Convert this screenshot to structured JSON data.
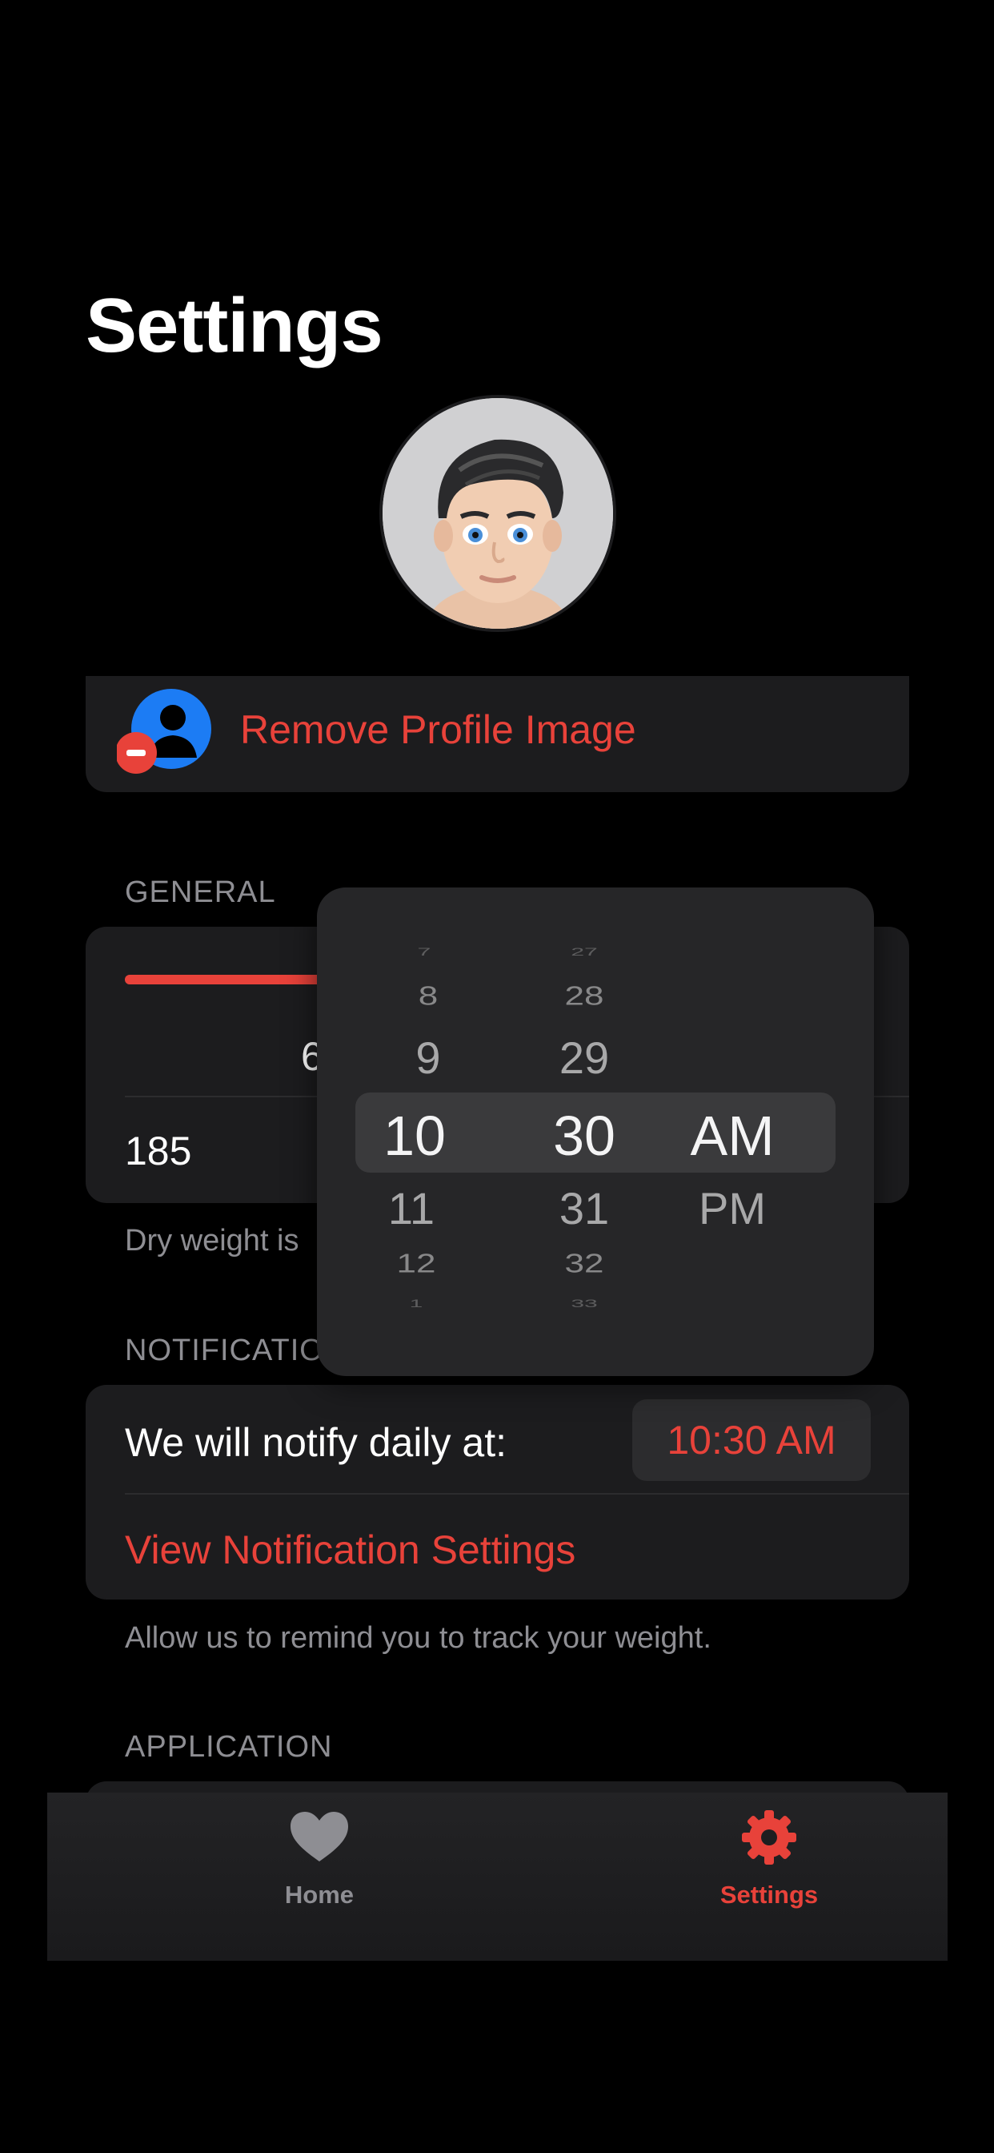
{
  "page": {
    "title": "Settings"
  },
  "profile": {
    "remove_label": "Remove Profile Image",
    "remove_icon": "person-remove-icon"
  },
  "general": {
    "header": "GENERAL",
    "slider_fill": 0.33,
    "center_value": "6",
    "weight_value": "185",
    "footer": "Dry weight is"
  },
  "notifications": {
    "header": "NOTIFICATIO",
    "label": "We will notify daily at:",
    "time": "10:30 AM",
    "link": "View Notification Settings",
    "footer": "Allow us to remind you to track your weight."
  },
  "application": {
    "header": "APPLICATION"
  },
  "time_picker": {
    "hours": [
      "7",
      "8",
      "9",
      "10",
      "11",
      "12",
      "1"
    ],
    "minutes": [
      "27",
      "28",
      "29",
      "30",
      "31",
      "32",
      "33"
    ],
    "periods": [
      "AM",
      "PM"
    ],
    "selected_hour": "10",
    "selected_minute": "30",
    "selected_period": "AM"
  },
  "tabbar": {
    "items": [
      {
        "label": "Home",
        "icon": "heart-icon",
        "active": false
      },
      {
        "label": "Settings",
        "icon": "gear-icon",
        "active": true
      }
    ]
  },
  "colors": {
    "accent": "#e8423a",
    "background": "#000000",
    "card": "#1c1c1e",
    "muted": "#8e8e93"
  }
}
